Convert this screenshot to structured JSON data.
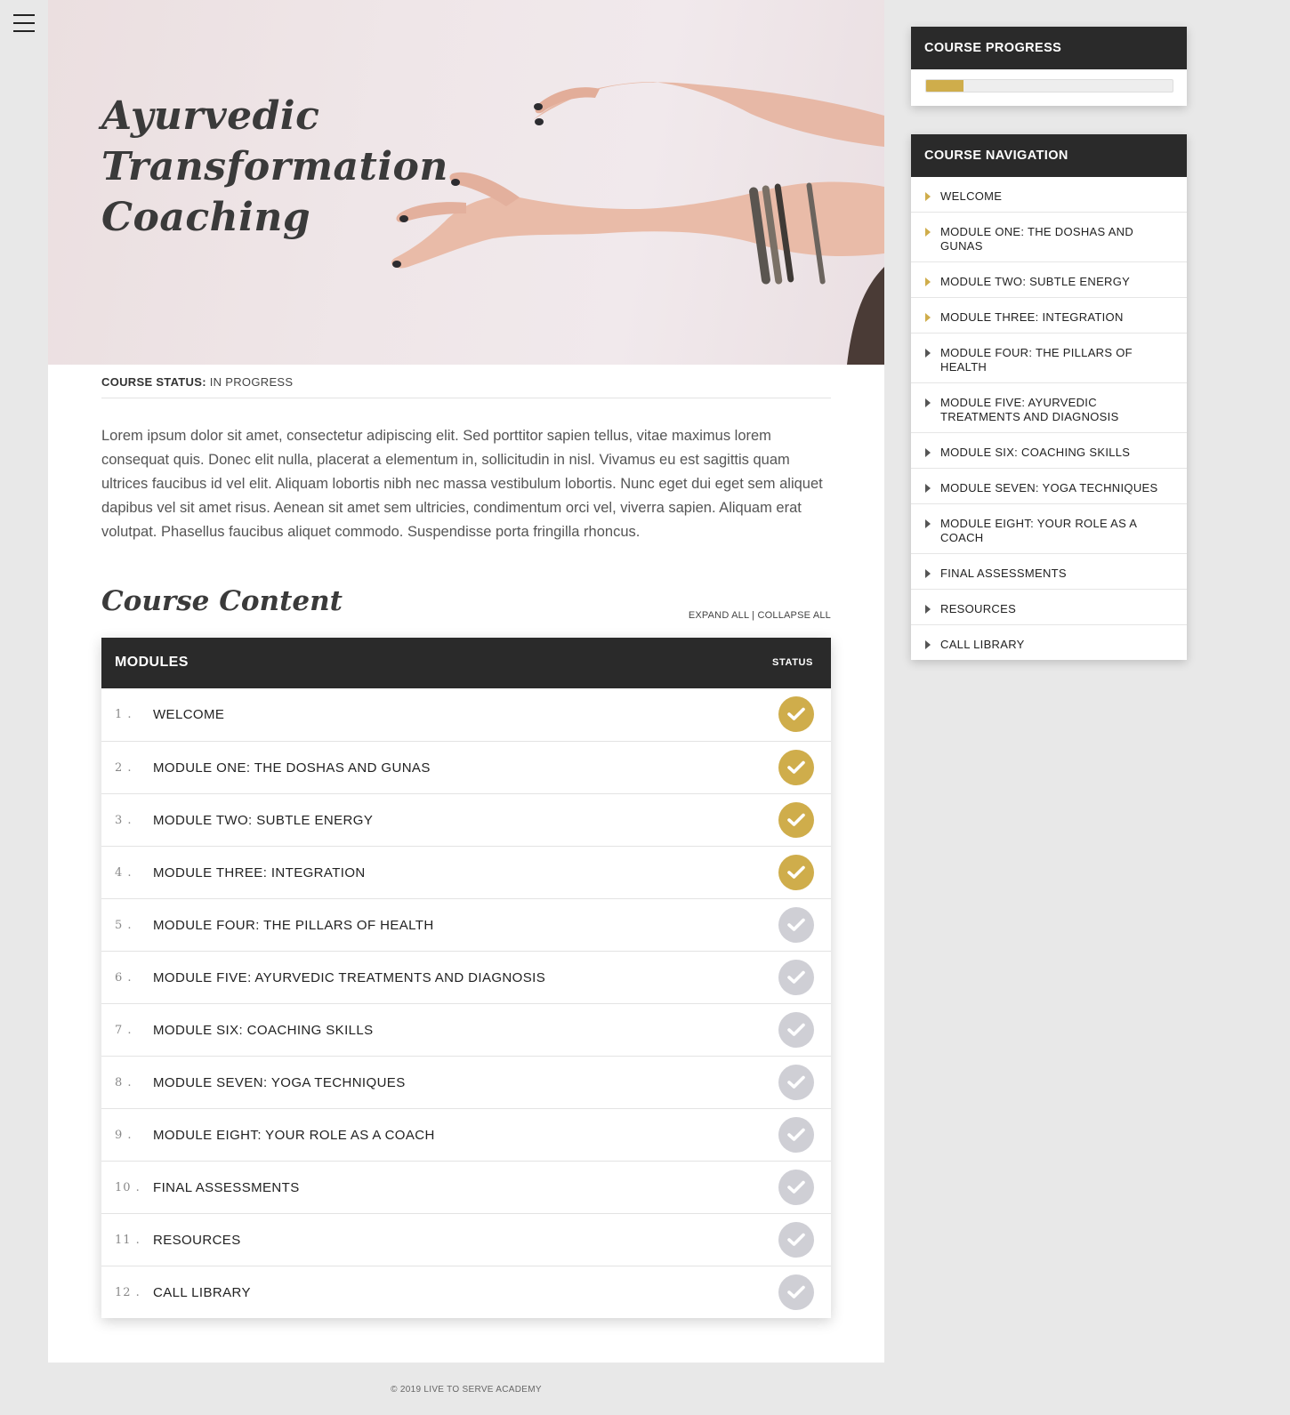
{
  "hero": {
    "title_lines": [
      "Ayurvedic",
      "Transformation",
      "Coaching"
    ]
  },
  "course_status": {
    "label": "COURSE STATUS:",
    "value": "IN PROGRESS"
  },
  "intro_text": "Lorem ipsum dolor sit amet, consectetur adipiscing elit. Sed porttitor sapien tellus, vitae maximus lorem consequat quis. Donec elit nulla, placerat a elementum in, sollicitudin in nisl. Vivamus eu est sagittis quam ultrices faucibus id vel elit. Aliquam lobortis nibh nec massa vestibulum lobortis. Nunc eget dui eget sem aliquet dapibus vel sit amet risus. Aenean sit amet sem ultricies, condimentum orci vel, viverra sapien. Aliquam erat volutpat. Phasellus faucibus aliquet commodo. Suspendisse porta fringilla rhoncus.",
  "course_content": {
    "title": "Course Content",
    "expand_all": "EXPAND ALL",
    "separator": "|",
    "collapse_all": "COLLAPSE ALL",
    "header_modules": "MODULES",
    "header_status": "STATUS",
    "modules": [
      {
        "num": "1 .",
        "title": "WELCOME",
        "complete": true
      },
      {
        "num": "2 .",
        "title": "MODULE ONE: THE DOSHAS AND GUNAS",
        "complete": true
      },
      {
        "num": "3 .",
        "title": "MODULE TWO: SUBTLE ENERGY",
        "complete": true
      },
      {
        "num": "4 .",
        "title": "MODULE THREE: INTEGRATION",
        "complete": true
      },
      {
        "num": "5 .",
        "title": "MODULE FOUR: THE PILLARS OF HEALTH",
        "complete": false
      },
      {
        "num": "6 .",
        "title": "MODULE FIVE: AYURVEDIC TREATMENTS AND DIAGNOSIS",
        "complete": false
      },
      {
        "num": "7 .",
        "title": "MODULE SIX: COACHING SKILLS",
        "complete": false
      },
      {
        "num": "8 .",
        "title": "MODULE SEVEN: YOGA TECHNIQUES",
        "complete": false
      },
      {
        "num": "9 .",
        "title": "MODULE EIGHT: YOUR ROLE AS A COACH",
        "complete": false
      },
      {
        "num": "10 .",
        "title": "FINAL ASSESSMENTS",
        "complete": false
      },
      {
        "num": "11 .",
        "title": "RESOURCES",
        "complete": false
      },
      {
        "num": "12 .",
        "title": "CALL LIBRARY",
        "complete": false
      }
    ]
  },
  "progress_widget": {
    "title": "COURSE PROGRESS",
    "percent": 15
  },
  "nav_widget": {
    "title": "COURSE NAVIGATION",
    "items": [
      {
        "label": "WELCOME",
        "complete": true
      },
      {
        "label": "MODULE ONE: THE DOSHAS AND GUNAS",
        "complete": true
      },
      {
        "label": "MODULE TWO: SUBTLE ENERGY",
        "complete": true
      },
      {
        "label": "MODULE THREE: INTEGRATION",
        "complete": true
      },
      {
        "label": "MODULE FOUR: THE PILLARS OF HEALTH",
        "complete": false
      },
      {
        "label": "MODULE FIVE: AYURVEDIC TREATMENTS AND DIAGNOSIS",
        "complete": false
      },
      {
        "label": "MODULE SIX: COACHING SKILLS",
        "complete": false
      },
      {
        "label": "MODULE SEVEN: YOGA TECHNIQUES",
        "complete": false
      },
      {
        "label": "MODULE EIGHT: YOUR ROLE AS A COACH",
        "complete": false
      },
      {
        "label": "FINAL ASSESSMENTS",
        "complete": false
      },
      {
        "label": "RESOURCES",
        "complete": false
      },
      {
        "label": "CALL LIBRARY",
        "complete": false
      }
    ]
  },
  "footer": "© 2019 LIVE TO SERVE ACADEMY",
  "colors": {
    "accent": "#cfad4b",
    "header_dark": "#2a2a2a",
    "incomplete": "#cfcfd5",
    "page_bg": "#e8e8e8"
  }
}
